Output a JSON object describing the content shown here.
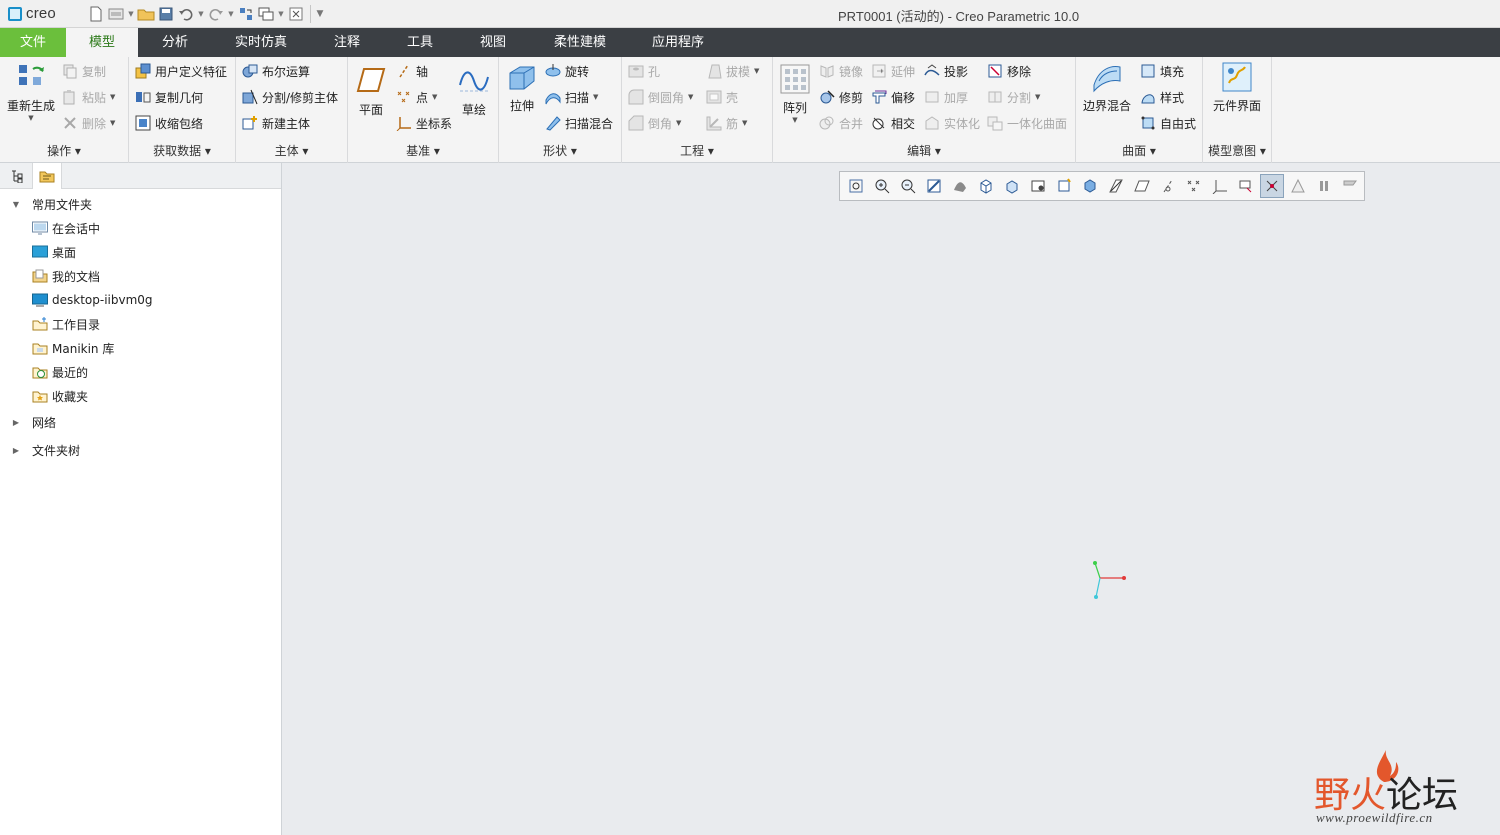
{
  "app": {
    "logo_text": "creo",
    "window_title": "PRT0001 (活动的) - Creo Parametric 10.0"
  },
  "tabs": [
    {
      "label": "文件"
    },
    {
      "label": "模型"
    },
    {
      "label": "分析"
    },
    {
      "label": "实时仿真"
    },
    {
      "label": "注释"
    },
    {
      "label": "工具"
    },
    {
      "label": "视图"
    },
    {
      "label": "柔性建模"
    },
    {
      "label": "应用程序"
    }
  ],
  "ribbon": {
    "operations": {
      "label": "操作",
      "regenerate": "重新生成",
      "copy": "复制",
      "paste": "粘贴",
      "delete": "删除"
    },
    "get_data": {
      "label": "获取数据",
      "udf": "用户定义特征",
      "copy_geom": "复制几何",
      "shrinkwrap": "收缩包络"
    },
    "body": {
      "label": "主体",
      "boolean": "布尔运算",
      "split_trim": "分割/修剪主体",
      "new_body": "新建主体"
    },
    "datum": {
      "label": "基准",
      "plane": "平面",
      "axis": "轴",
      "point": "点",
      "csys": "坐标系",
      "sketch": "草绘"
    },
    "shapes": {
      "label": "形状",
      "extrude": "拉伸",
      "revolve": "旋转",
      "sweep": "扫描",
      "swept_blend": "扫描混合"
    },
    "engineering": {
      "label": "工程",
      "hole": "孔",
      "round": "倒圆角",
      "chamfer": "倒角",
      "draft": "拔模",
      "shell": "壳",
      "rib": "筋"
    },
    "editing": {
      "label": "编辑",
      "pattern": "阵列",
      "mirror": "镜像",
      "extend": "延伸",
      "project": "投影",
      "remove": "移除",
      "trim": "修剪",
      "offset": "偏移",
      "thicken": "加厚",
      "split": "分割",
      "merge": "合并",
      "intersect": "相交",
      "solidify": "实体化",
      "unify": "一体化曲面"
    },
    "surfaces": {
      "label": "曲面",
      "boundary_blend": "边界混合",
      "fill": "填充",
      "style": "样式",
      "freestyle": "自由式"
    },
    "model_intent": {
      "label": "模型意图",
      "component_interface": "元件界面"
    }
  },
  "navigator": {
    "items": [
      {
        "label": "常用文件夹"
      },
      {
        "label": "在会话中"
      },
      {
        "label": "桌面"
      },
      {
        "label": "我的文档"
      },
      {
        "label": "desktop-iibvm0g"
      },
      {
        "label": "工作目录"
      },
      {
        "label": "Manikin 库"
      },
      {
        "label": "最近的"
      },
      {
        "label": "收藏夹"
      },
      {
        "label": "网络"
      },
      {
        "label": "文件夹树"
      }
    ]
  },
  "watermark": {
    "cn_red": "野火",
    "cn_black": "论坛",
    "url": "www.proewildfire.cn"
  },
  "colors": {
    "tab_bar": "#3b3f44",
    "file_tab": "#6bbf3c",
    "active_tab_text": "#2d7a1a",
    "graphics_bg": "#e9ebee",
    "axis_x": "#e23a3a",
    "axis_y": "#3ccf4a",
    "axis_z": "#3fc7d9"
  }
}
